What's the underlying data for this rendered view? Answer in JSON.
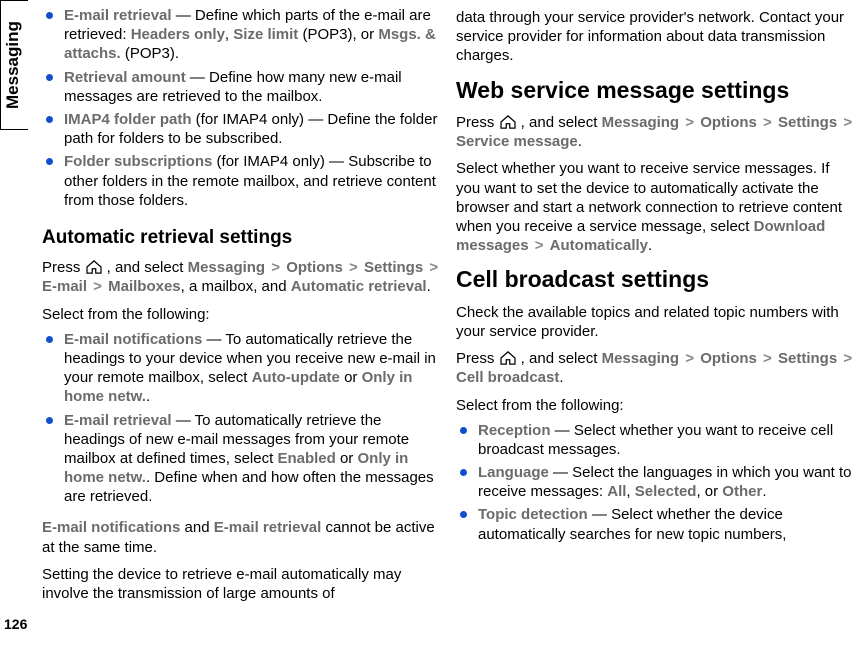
{
  "sidebar": {
    "label": "Messaging"
  },
  "page_number": "126",
  "left": {
    "top_bullets": [
      {
        "name": "bullet-email-retrieval-parts",
        "term": "E-mail retrieval",
        "pre": " — Define which parts of the e-mail are retrieved: ",
        "opt1": "Headers only",
        "mid1": ", ",
        "opt2": "Size limit",
        "mid2": " (POP3), or ",
        "opt3": "Msgs. & attachs.",
        "post": " (POP3)."
      },
      {
        "name": "bullet-retrieval-amount",
        "term": "Retrieval amount",
        "text": " — Define how many new e-mail messages are retrieved to the mailbox."
      },
      {
        "name": "bullet-imap4-folder-path",
        "term": "IMAP4 folder path",
        "suffix": " (for IMAP4 only)  — Define the folder path for folders to be subscribed."
      },
      {
        "name": "bullet-folder-subscriptions",
        "term": "Folder subscriptions",
        "suffix": " (for IMAP4 only)  — Subscribe to other folders in the remote mailbox, and retrieve content from those folders."
      }
    ],
    "auto_heading": "Automatic retrieval settings",
    "auto_intro_pre": "Press ",
    "auto_intro_mid": " , and select ",
    "auto_crumbs": [
      "Messaging",
      "Options",
      "Settings",
      "E-mail",
      "Mailboxes"
    ],
    "auto_intro_post1": ", a mailbox, and ",
    "auto_crumb_last": "Automatic retrieval",
    "auto_intro_post2": ".",
    "select_from": "Select from the following:",
    "auto_bullets": [
      {
        "name": "bullet-email-notifications",
        "term": "E-mail notifications",
        "pre": " — To automatically retrieve the headings to your device when you receive new e-mail in your remote mailbox, select ",
        "opt1": "Auto-update",
        "mid": " or ",
        "opt2": "Only in home netw.",
        "post": "."
      },
      {
        "name": "bullet-auto-email-retrieval",
        "term": "E-mail retrieval",
        "pre": " — To automatically retrieve the headings of new e-mail messages from your remote mailbox at defined times, select ",
        "opt1": "Enabled",
        "mid": " or ",
        "opt2": "Only in home netw.",
        "post": ". Define when and how often the messages are retrieved."
      }
    ],
    "note_t1": "E-mail notifications",
    "note_mid": " and ",
    "note_t2": "E-mail retrieval",
    "note_post": " cannot be active at the same time.",
    "tail": "Setting the device to retrieve e-mail automatically may involve the transmission of large amounts of"
  },
  "right": {
    "continuation": "data through your service provider's network. Contact your service provider for information about data transmission charges.",
    "web_heading": "Web service message settings",
    "web_intro_pre": "Press ",
    "web_intro_mid": " , and select ",
    "web_crumbs": [
      "Messaging",
      "Options",
      "Settings",
      "Service message"
    ],
    "web_intro_post": ".",
    "web_para_pre": "Select whether you want to receive service messages. If you want to set the device to automatically activate the browser and start a network connection to retrieve content when you receive a service message, select ",
    "web_para_t1": "Download messages",
    "web_para_t2": "Automatically",
    "web_para_post": ".",
    "cb_heading": "Cell broadcast settings",
    "cb_intro": "Check the available topics and related topic numbers with your service provider.",
    "cb_press_pre": "Press ",
    "cb_press_mid": " , and select ",
    "cb_crumbs": [
      "Messaging",
      "Options",
      "Settings",
      "Cell broadcast"
    ],
    "cb_press_post": ".",
    "select_from": "Select from the following:",
    "cb_bullets": [
      {
        "name": "bullet-reception",
        "term": "Reception",
        "text": " — Select whether you want to receive cell broadcast messages."
      },
      {
        "name": "bullet-language",
        "term": "Language",
        "pre": " — Select the languages in which you want to receive messages: ",
        "opt1": "All",
        "mid1": ", ",
        "opt2": "Selected",
        "mid2": ", or ",
        "opt3": "Other",
        "post": "."
      },
      {
        "name": "bullet-topic-detection",
        "term": "Topic detection",
        "text": " — Select whether the device automatically searches for new topic numbers,"
      }
    ]
  }
}
